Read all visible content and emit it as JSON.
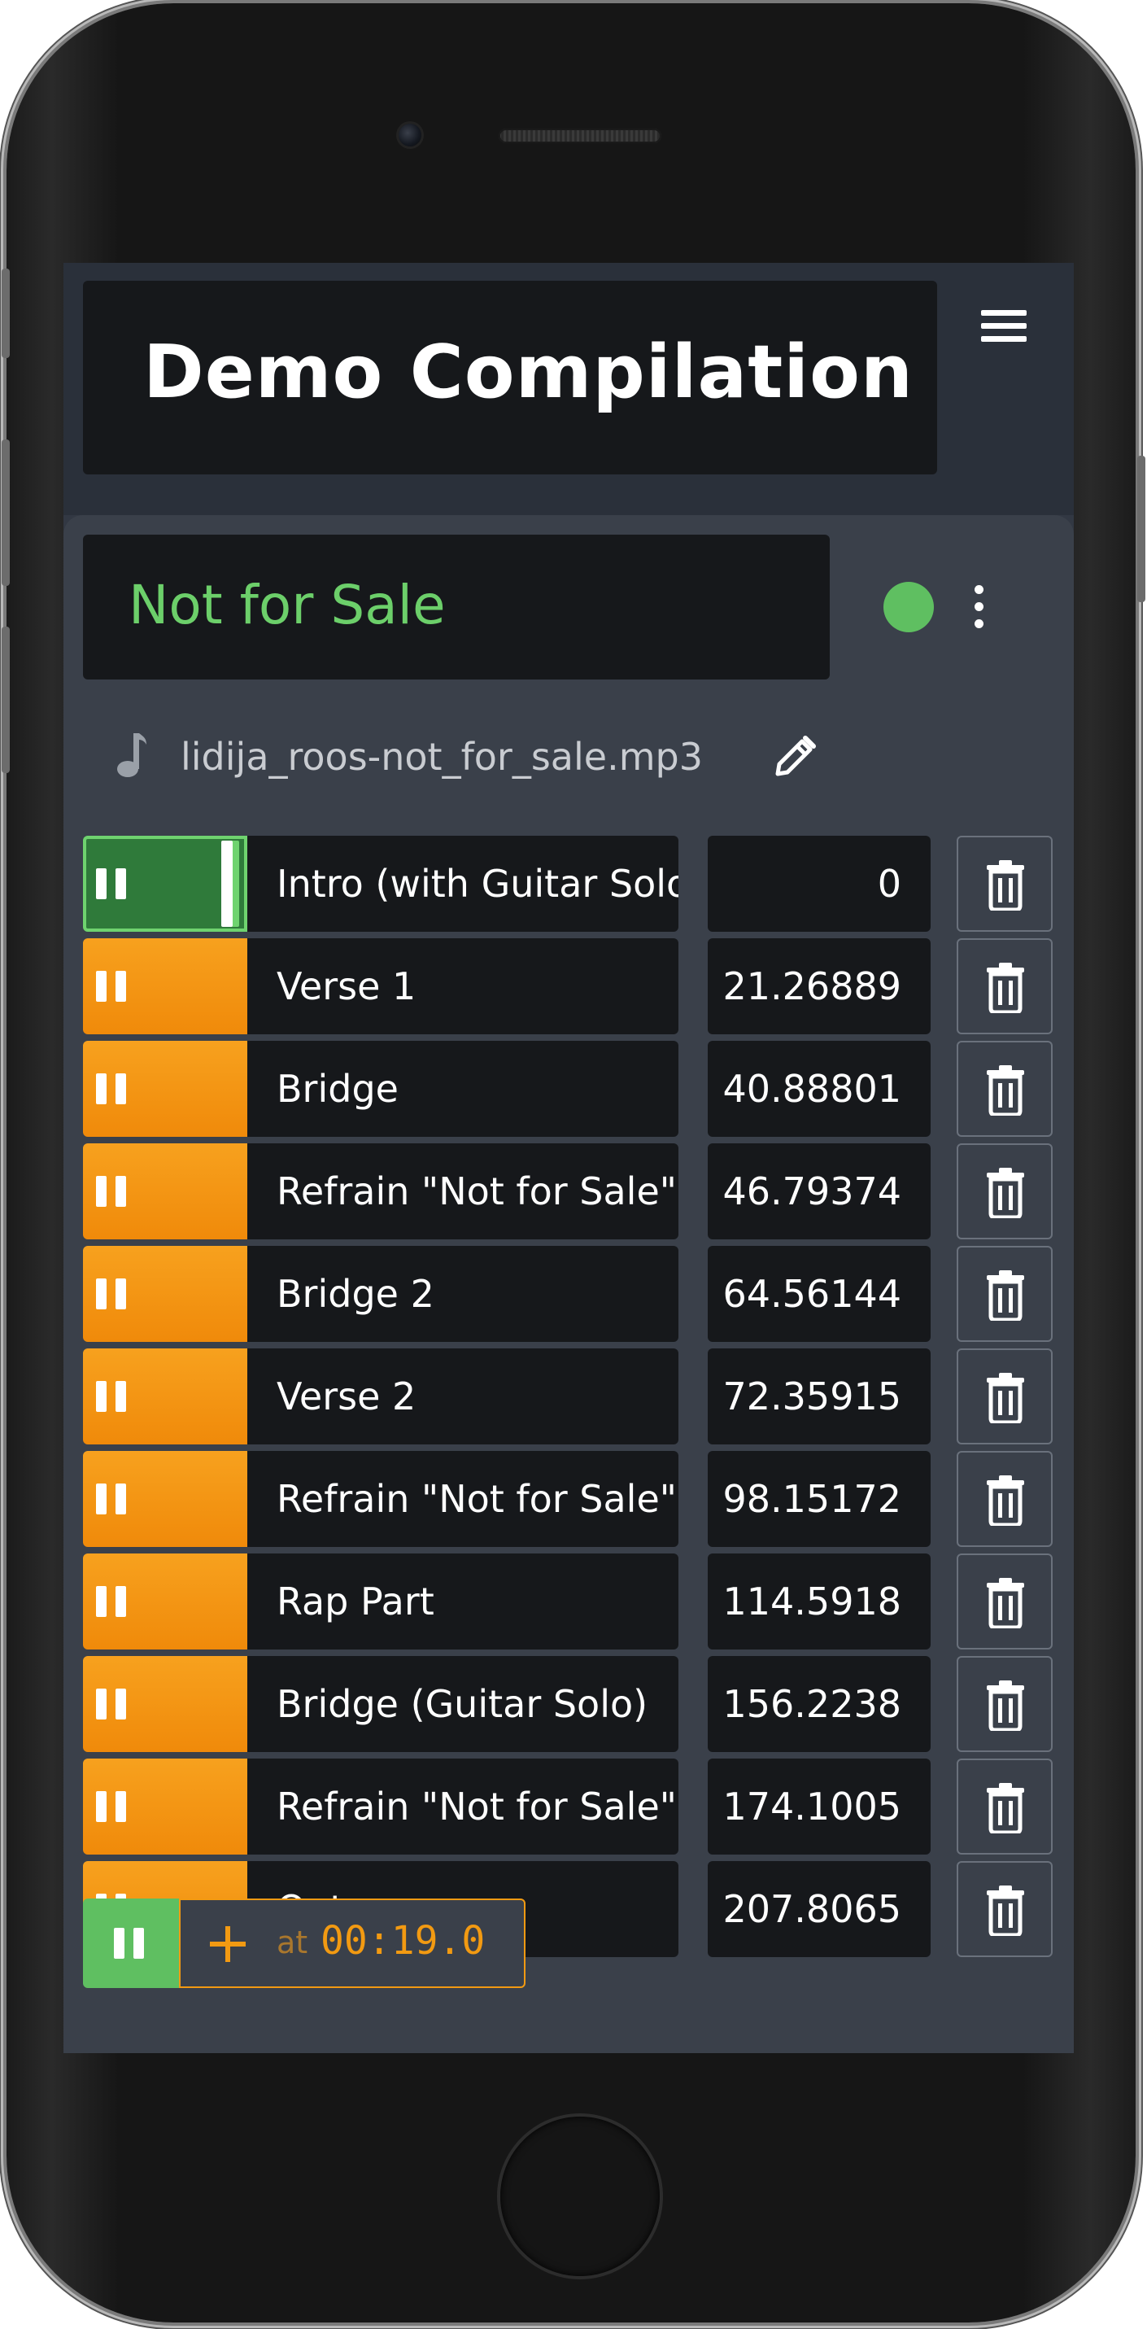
{
  "header": {
    "title": "Demo Compilation (",
    "menu_icon": "hamburger-menu-icon"
  },
  "song": {
    "title": "Not for Sale",
    "status_color": "#5fbf61",
    "file_name": "lidija_roos-not_for_sale.mp3"
  },
  "colors": {
    "accent_orange": "#f29a12",
    "accent_green": "#5fbf61",
    "panel": "#16181b",
    "background": "#3a404a"
  },
  "cues": [
    {
      "label": "Intro (with Guitar Solo)",
      "time": "0",
      "active": true
    },
    {
      "label": "Verse 1",
      "time": "21.26889",
      "active": false
    },
    {
      "label": "Bridge",
      "time": "40.88801",
      "active": false
    },
    {
      "label": "Refrain \"Not for Sale\"",
      "time": "46.79374",
      "active": false
    },
    {
      "label": "Bridge 2",
      "time": "64.56144",
      "active": false
    },
    {
      "label": "Verse 2",
      "time": "72.35915",
      "active": false
    },
    {
      "label": "Refrain \"Not for Sale\"",
      "time": "98.15172",
      "active": false
    },
    {
      "label": "Rap Part",
      "time": "114.5918",
      "active": false
    },
    {
      "label": "Bridge (Guitar Solo)",
      "time": "156.2238",
      "active": false
    },
    {
      "label": "Refrain \"Not for Sale\"",
      "time": "174.1005",
      "active": false
    },
    {
      "label": "Outro",
      "time": "207.8065",
      "active": false
    }
  ],
  "add_cue": {
    "at_label": "at",
    "position": "00:19.0"
  }
}
